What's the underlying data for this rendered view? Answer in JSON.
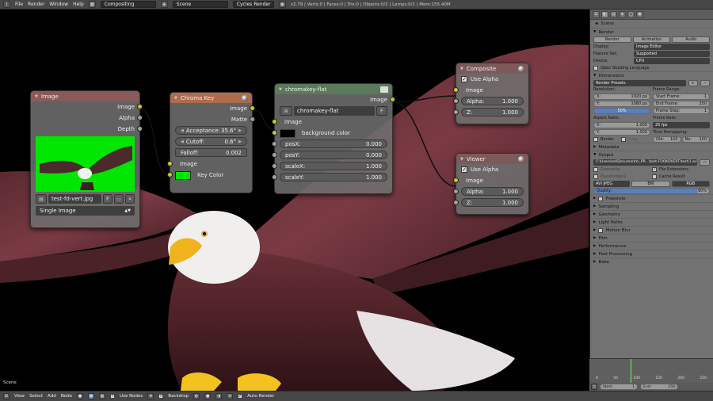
{
  "topbar": {
    "menus": [
      "File",
      "Render",
      "Window",
      "Help"
    ],
    "screen_layout": "Compositing",
    "scene": "Scene",
    "engine": "Cycles Render",
    "stats": "v2.79 | Verts:0 | Faces:0 | Tris:0 | Objects:0/2 | Lamps:0/1 | Mem:155.40M"
  },
  "canvas": {
    "scene_label": "Scene"
  },
  "nodes": {
    "image": {
      "title": "Image",
      "outputs": [
        "Image",
        "Alpha",
        "Depth"
      ],
      "filename": "test-fd-vert.jpg",
      "f_label": "F",
      "source": "Single Image"
    },
    "chroma": {
      "title": "Chroma Key",
      "outputs": [
        "Image",
        "Matte"
      ],
      "acceptance_label": "Acceptance:",
      "acceptance": "35.6°",
      "cutoff_label": "Cutoff:",
      "cutoff": "0.6°",
      "falloff_label": "Falloff:",
      "falloff": "0.002",
      "in_image": "Image",
      "key_color_label": "Key Color",
      "key_color": "#00e600"
    },
    "group": {
      "title": "chromakey-flat",
      "output": "Image",
      "group_name": "chromakey-flat",
      "f_label": "F",
      "in_image": "Image",
      "bg_label": "background color",
      "bg_color": "#000000",
      "fields": [
        {
          "label": "posX:",
          "value": "0.000"
        },
        {
          "label": "posY:",
          "value": "0.000"
        },
        {
          "label": "scaleX:",
          "value": "1.000"
        },
        {
          "label": "scaleY:",
          "value": "1.000"
        }
      ]
    },
    "composite": {
      "title": "Composite",
      "use_alpha": "Use Alpha",
      "in_image": "Image",
      "alpha_label": "Alpha:",
      "alpha": "1.000",
      "z_label": "Z:",
      "z": "1.000"
    },
    "viewer": {
      "title": "Viewer",
      "use_alpha": "Use Alpha",
      "in_image": "Image",
      "alpha_label": "Alpha:",
      "alpha": "1.000",
      "z_label": "Z:",
      "z": "1.000"
    }
  },
  "colors": {
    "socket_image": "#c7c729",
    "socket_value": "#a1a1a1",
    "selection": "#5680c2"
  },
  "properties": {
    "scene_breadcrumb": "Scene",
    "render": {
      "title": "Render",
      "buttons": [
        "Render",
        "Animation",
        "Audio"
      ],
      "display_label": "Display:",
      "display": "Image Editor",
      "feature_label": "Feature Set:",
      "feature": "Supported",
      "device_label": "Device:",
      "device": "CPU",
      "osl_label": "Open Shading Language"
    },
    "dimensions": {
      "title": "Dimensions",
      "presets": "Render Presets",
      "resolution_label": "Resolution:",
      "res_x_label": "X:",
      "res_x": "1920 px",
      "res_y_label": "Y:",
      "res_y": "1080 px",
      "res_pct": "50%",
      "frame_range_label": "Frame Range:",
      "start_label": "Start Frame:",
      "start": "1",
      "end_label": "End Frame:",
      "end": "250",
      "step_label": "Frame Step:",
      "step": "1",
      "aspect_label": "Aspect Ratio:",
      "asp_x_label": "X:",
      "asp_x": "1.000",
      "asp_y_label": "Y:",
      "asp_y": "1.000",
      "frame_rate_label": "Frame Rate:",
      "frame_rate": "25 fps",
      "time_remap_label": "Time Remapping:",
      "old_label": "Old:",
      "old": "100",
      "new_label": "Ne:",
      "new": "100",
      "border_label": "Border",
      "crop_label": "Crop"
    },
    "metadata_title": "Metadata",
    "output": {
      "title": "Output",
      "path": "C:\\Users\\ed\\Documents\\_PR...\\test-FOOKDVERT\\test\\1.avi",
      "overwrite_label": "Overwrite",
      "file_ext_label": "File Extensions",
      "placeholders_label": "Placeholders",
      "cache_label": "Cache Result",
      "format": "AVI JPEG",
      "bw": "BW",
      "rgb": "RGB",
      "quality_label": "Quality:",
      "quality": "90%"
    },
    "collapsed": [
      "Freestyle",
      "Sampling",
      "Geometry",
      "Light Paths",
      "Motion Blur",
      "Film",
      "Performance",
      "Post Processing",
      "Bake"
    ]
  },
  "timeline": {
    "ticks": [
      "0",
      "50",
      "100",
      "150",
      "200",
      "250"
    ],
    "start_label": "Start:",
    "start": "1",
    "end_label": "End:",
    "end": "250",
    "current_frame": 1
  },
  "bottombar": {
    "menus": [
      "View",
      "Select",
      "Add",
      "Node"
    ],
    "use_nodes": "Use Nodes",
    "backdrop": "Backdrop",
    "auto_render": "Auto Render"
  }
}
